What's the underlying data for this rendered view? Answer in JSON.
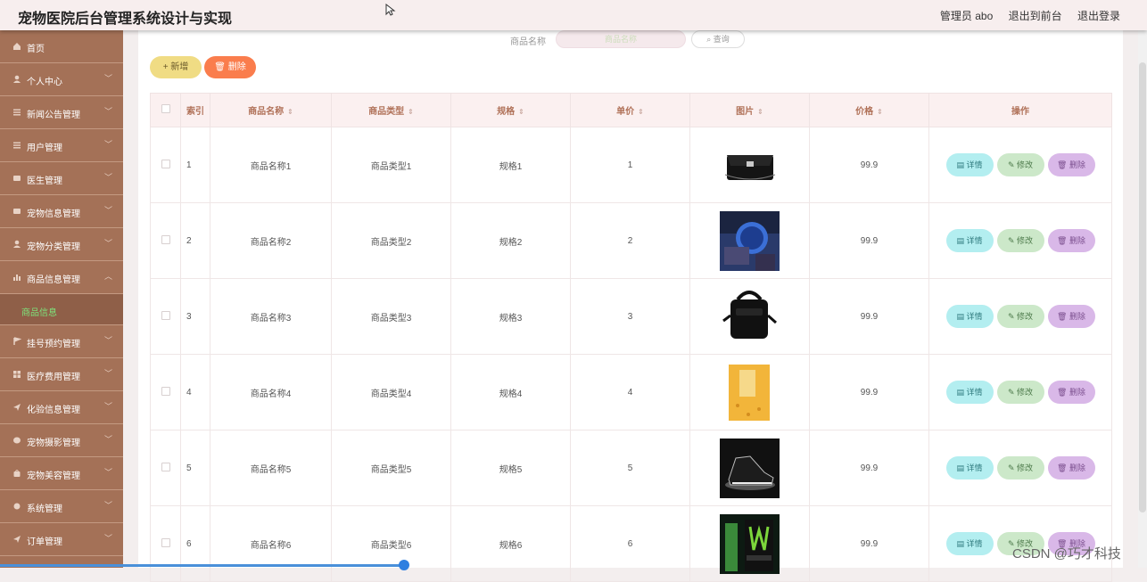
{
  "header": {
    "title": "宠物医院后台管理系统设计与实现",
    "admin_label": "管理员 abo",
    "to_front": "退出到前台",
    "logout": "退出登录"
  },
  "sidebar": {
    "items": [
      {
        "label": "首页",
        "icon": "home-icon"
      },
      {
        "label": "个人中心",
        "icon": "user-icon"
      },
      {
        "label": "新闻公告管理",
        "icon": "list-icon"
      },
      {
        "label": "用户管理",
        "icon": "list-icon"
      },
      {
        "label": "医生管理",
        "icon": "card-icon"
      },
      {
        "label": "宠物信息管理",
        "icon": "card-icon"
      },
      {
        "label": "宠物分类管理",
        "icon": "user-icon"
      },
      {
        "label": "商品信息管理",
        "icon": "chart-icon"
      }
    ],
    "submenu_label": "商品信息",
    "items_after": [
      {
        "label": "挂号预约管理",
        "icon": "flag-icon"
      },
      {
        "label": "医疗费用管理",
        "icon": "grid-icon"
      },
      {
        "label": "化验信息管理",
        "icon": "send-icon"
      },
      {
        "label": "宠物摄影管理",
        "icon": "camera-icon"
      },
      {
        "label": "宠物美容管理",
        "icon": "bag-icon"
      },
      {
        "label": "系统管理",
        "icon": "settings-icon"
      },
      {
        "label": "订单管理",
        "icon": "send-icon"
      }
    ]
  },
  "search": {
    "label": "商品名称",
    "placeholder": "商品名称",
    "button": "查询"
  },
  "toolbar": {
    "add_label": "+ 新增",
    "delete_label": "🗑 删除"
  },
  "table": {
    "columns": [
      "索引",
      "商品名称",
      "商品类型",
      "规格",
      "单价",
      "图片",
      "价格",
      "操作"
    ],
    "rows": [
      {
        "index": "1",
        "name": "商品名称1",
        "type": "商品类型1",
        "spec": "规格1",
        "unit": "1",
        "image": "handbag",
        "price": "99.9"
      },
      {
        "index": "2",
        "name": "商品名称2",
        "type": "商品类型2",
        "spec": "规格2",
        "unit": "2",
        "image": "watch",
        "price": "99.9"
      },
      {
        "index": "3",
        "name": "商品名称3",
        "type": "商品类型3",
        "spec": "规格3",
        "unit": "3",
        "image": "bag",
        "price": "99.9"
      },
      {
        "index": "4",
        "name": "商品名称4",
        "type": "商品类型4",
        "spec": "规格4",
        "unit": "4",
        "image": "book",
        "price": "99.9"
      },
      {
        "index": "5",
        "name": "商品名称5",
        "type": "商品类型5",
        "spec": "规格5",
        "unit": "5",
        "image": "shoes",
        "price": "99.9"
      },
      {
        "index": "6",
        "name": "商品名称6",
        "type": "商品类型6",
        "spec": "规格6",
        "unit": "6",
        "image": "drink",
        "price": "99.9"
      }
    ],
    "ops": {
      "detail": "详情",
      "edit": "修改",
      "delete": "删除"
    }
  },
  "watermark": "CSDN @巧才科技",
  "colors": {
    "sidebar": "#a47157",
    "header_bg": "#f7eeee",
    "add_btn": "#f0dc84",
    "del_btn": "#fa7d4d"
  }
}
